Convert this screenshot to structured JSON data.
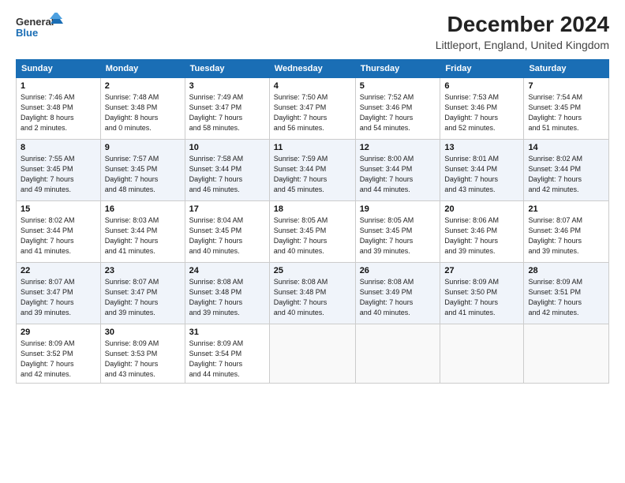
{
  "header": {
    "logo_line1": "General",
    "logo_line2": "Blue",
    "title": "December 2024",
    "subtitle": "Littleport, England, United Kingdom"
  },
  "columns": [
    "Sunday",
    "Monday",
    "Tuesday",
    "Wednesday",
    "Thursday",
    "Friday",
    "Saturday"
  ],
  "weeks": [
    [
      {
        "day": "1",
        "info": "Sunrise: 7:46 AM\nSunset: 3:48 PM\nDaylight: 8 hours\nand 2 minutes."
      },
      {
        "day": "2",
        "info": "Sunrise: 7:48 AM\nSunset: 3:48 PM\nDaylight: 8 hours\nand 0 minutes."
      },
      {
        "day": "3",
        "info": "Sunrise: 7:49 AM\nSunset: 3:47 PM\nDaylight: 7 hours\nand 58 minutes."
      },
      {
        "day": "4",
        "info": "Sunrise: 7:50 AM\nSunset: 3:47 PM\nDaylight: 7 hours\nand 56 minutes."
      },
      {
        "day": "5",
        "info": "Sunrise: 7:52 AM\nSunset: 3:46 PM\nDaylight: 7 hours\nand 54 minutes."
      },
      {
        "day": "6",
        "info": "Sunrise: 7:53 AM\nSunset: 3:46 PM\nDaylight: 7 hours\nand 52 minutes."
      },
      {
        "day": "7",
        "info": "Sunrise: 7:54 AM\nSunset: 3:45 PM\nDaylight: 7 hours\nand 51 minutes."
      }
    ],
    [
      {
        "day": "8",
        "info": "Sunrise: 7:55 AM\nSunset: 3:45 PM\nDaylight: 7 hours\nand 49 minutes."
      },
      {
        "day": "9",
        "info": "Sunrise: 7:57 AM\nSunset: 3:45 PM\nDaylight: 7 hours\nand 48 minutes."
      },
      {
        "day": "10",
        "info": "Sunrise: 7:58 AM\nSunset: 3:44 PM\nDaylight: 7 hours\nand 46 minutes."
      },
      {
        "day": "11",
        "info": "Sunrise: 7:59 AM\nSunset: 3:44 PM\nDaylight: 7 hours\nand 45 minutes."
      },
      {
        "day": "12",
        "info": "Sunrise: 8:00 AM\nSunset: 3:44 PM\nDaylight: 7 hours\nand 44 minutes."
      },
      {
        "day": "13",
        "info": "Sunrise: 8:01 AM\nSunset: 3:44 PM\nDaylight: 7 hours\nand 43 minutes."
      },
      {
        "day": "14",
        "info": "Sunrise: 8:02 AM\nSunset: 3:44 PM\nDaylight: 7 hours\nand 42 minutes."
      }
    ],
    [
      {
        "day": "15",
        "info": "Sunrise: 8:02 AM\nSunset: 3:44 PM\nDaylight: 7 hours\nand 41 minutes."
      },
      {
        "day": "16",
        "info": "Sunrise: 8:03 AM\nSunset: 3:44 PM\nDaylight: 7 hours\nand 41 minutes."
      },
      {
        "day": "17",
        "info": "Sunrise: 8:04 AM\nSunset: 3:45 PM\nDaylight: 7 hours\nand 40 minutes."
      },
      {
        "day": "18",
        "info": "Sunrise: 8:05 AM\nSunset: 3:45 PM\nDaylight: 7 hours\nand 40 minutes."
      },
      {
        "day": "19",
        "info": "Sunrise: 8:05 AM\nSunset: 3:45 PM\nDaylight: 7 hours\nand 39 minutes."
      },
      {
        "day": "20",
        "info": "Sunrise: 8:06 AM\nSunset: 3:46 PM\nDaylight: 7 hours\nand 39 minutes."
      },
      {
        "day": "21",
        "info": "Sunrise: 8:07 AM\nSunset: 3:46 PM\nDaylight: 7 hours\nand 39 minutes."
      }
    ],
    [
      {
        "day": "22",
        "info": "Sunrise: 8:07 AM\nSunset: 3:47 PM\nDaylight: 7 hours\nand 39 minutes."
      },
      {
        "day": "23",
        "info": "Sunrise: 8:07 AM\nSunset: 3:47 PM\nDaylight: 7 hours\nand 39 minutes."
      },
      {
        "day": "24",
        "info": "Sunrise: 8:08 AM\nSunset: 3:48 PM\nDaylight: 7 hours\nand 39 minutes."
      },
      {
        "day": "25",
        "info": "Sunrise: 8:08 AM\nSunset: 3:48 PM\nDaylight: 7 hours\nand 40 minutes."
      },
      {
        "day": "26",
        "info": "Sunrise: 8:08 AM\nSunset: 3:49 PM\nDaylight: 7 hours\nand 40 minutes."
      },
      {
        "day": "27",
        "info": "Sunrise: 8:09 AM\nSunset: 3:50 PM\nDaylight: 7 hours\nand 41 minutes."
      },
      {
        "day": "28",
        "info": "Sunrise: 8:09 AM\nSunset: 3:51 PM\nDaylight: 7 hours\nand 42 minutes."
      }
    ],
    [
      {
        "day": "29",
        "info": "Sunrise: 8:09 AM\nSunset: 3:52 PM\nDaylight: 7 hours\nand 42 minutes."
      },
      {
        "day": "30",
        "info": "Sunrise: 8:09 AM\nSunset: 3:53 PM\nDaylight: 7 hours\nand 43 minutes."
      },
      {
        "day": "31",
        "info": "Sunrise: 8:09 AM\nSunset: 3:54 PM\nDaylight: 7 hours\nand 44 minutes."
      },
      {
        "day": "",
        "info": ""
      },
      {
        "day": "",
        "info": ""
      },
      {
        "day": "",
        "info": ""
      },
      {
        "day": "",
        "info": ""
      }
    ]
  ]
}
